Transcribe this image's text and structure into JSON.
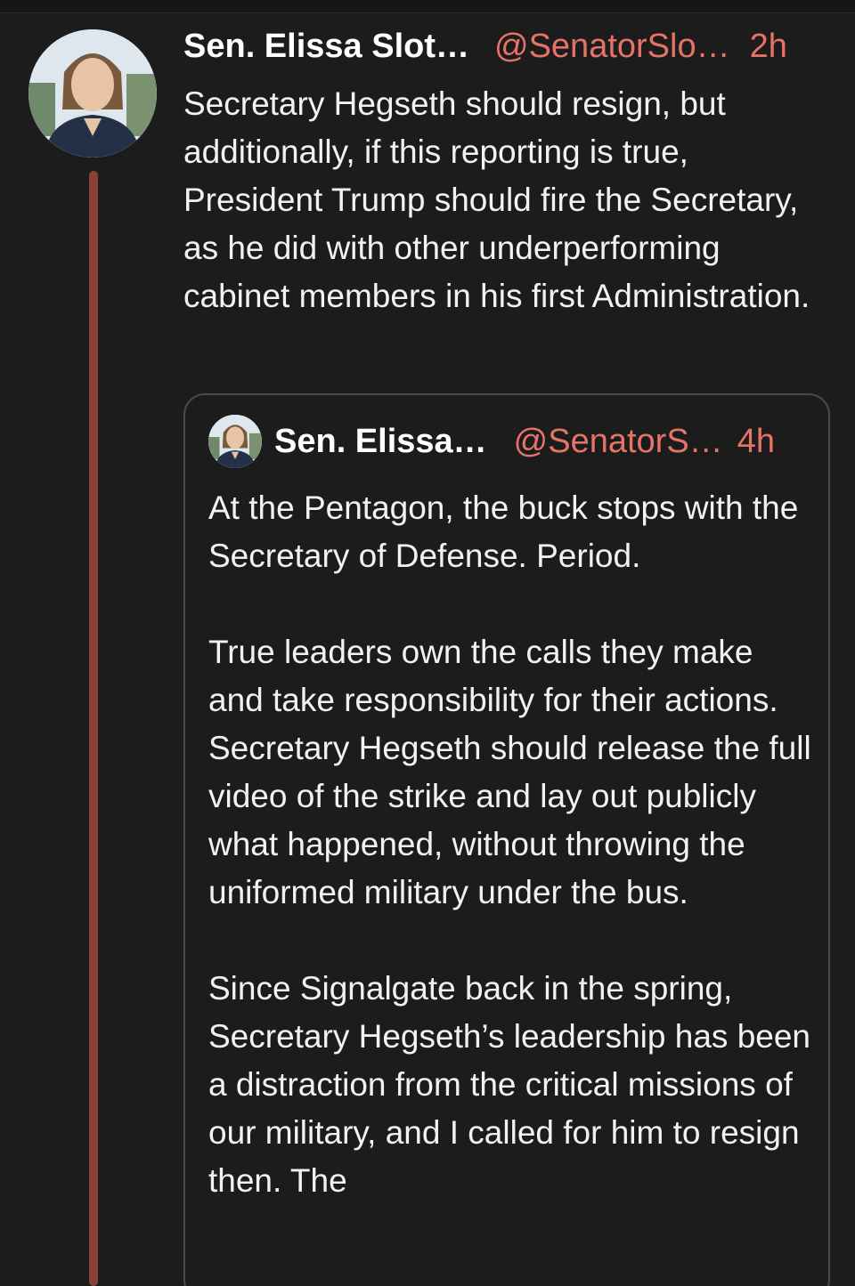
{
  "post": {
    "author_name": "Sen. Elissa Slot…",
    "handle": "@SenatorSlo…",
    "time": "2h",
    "text": "Secretary Hegseth should resign, but additionally, if this reporting is true, President Trump should fire the Secretary, as he did with other underperforming cabinet members in his first Administration."
  },
  "quote": {
    "author_name": "Sen. Elissa…",
    "handle": "@SenatorS…",
    "time": "4h",
    "paragraphs": [
      "At the Pentagon, the buck stops with the Secretary of Defense. Period.",
      "True leaders own the calls they make and take responsibility for their actions. Secretary Hegseth should release the full video of the strike and lay out publicly what happened, without throwing the uniformed military under the bus.",
      "Since Signalgate back in the spring, Secretary Hegseth’s leadership has been a distraction from the critical missions of our military, and I called for him to resign then. The"
    ]
  },
  "colors": {
    "background": "#1c1c1d",
    "accent": "#e57368",
    "thread_line": "#8a3f37",
    "card_border": "#4a4a4c"
  }
}
